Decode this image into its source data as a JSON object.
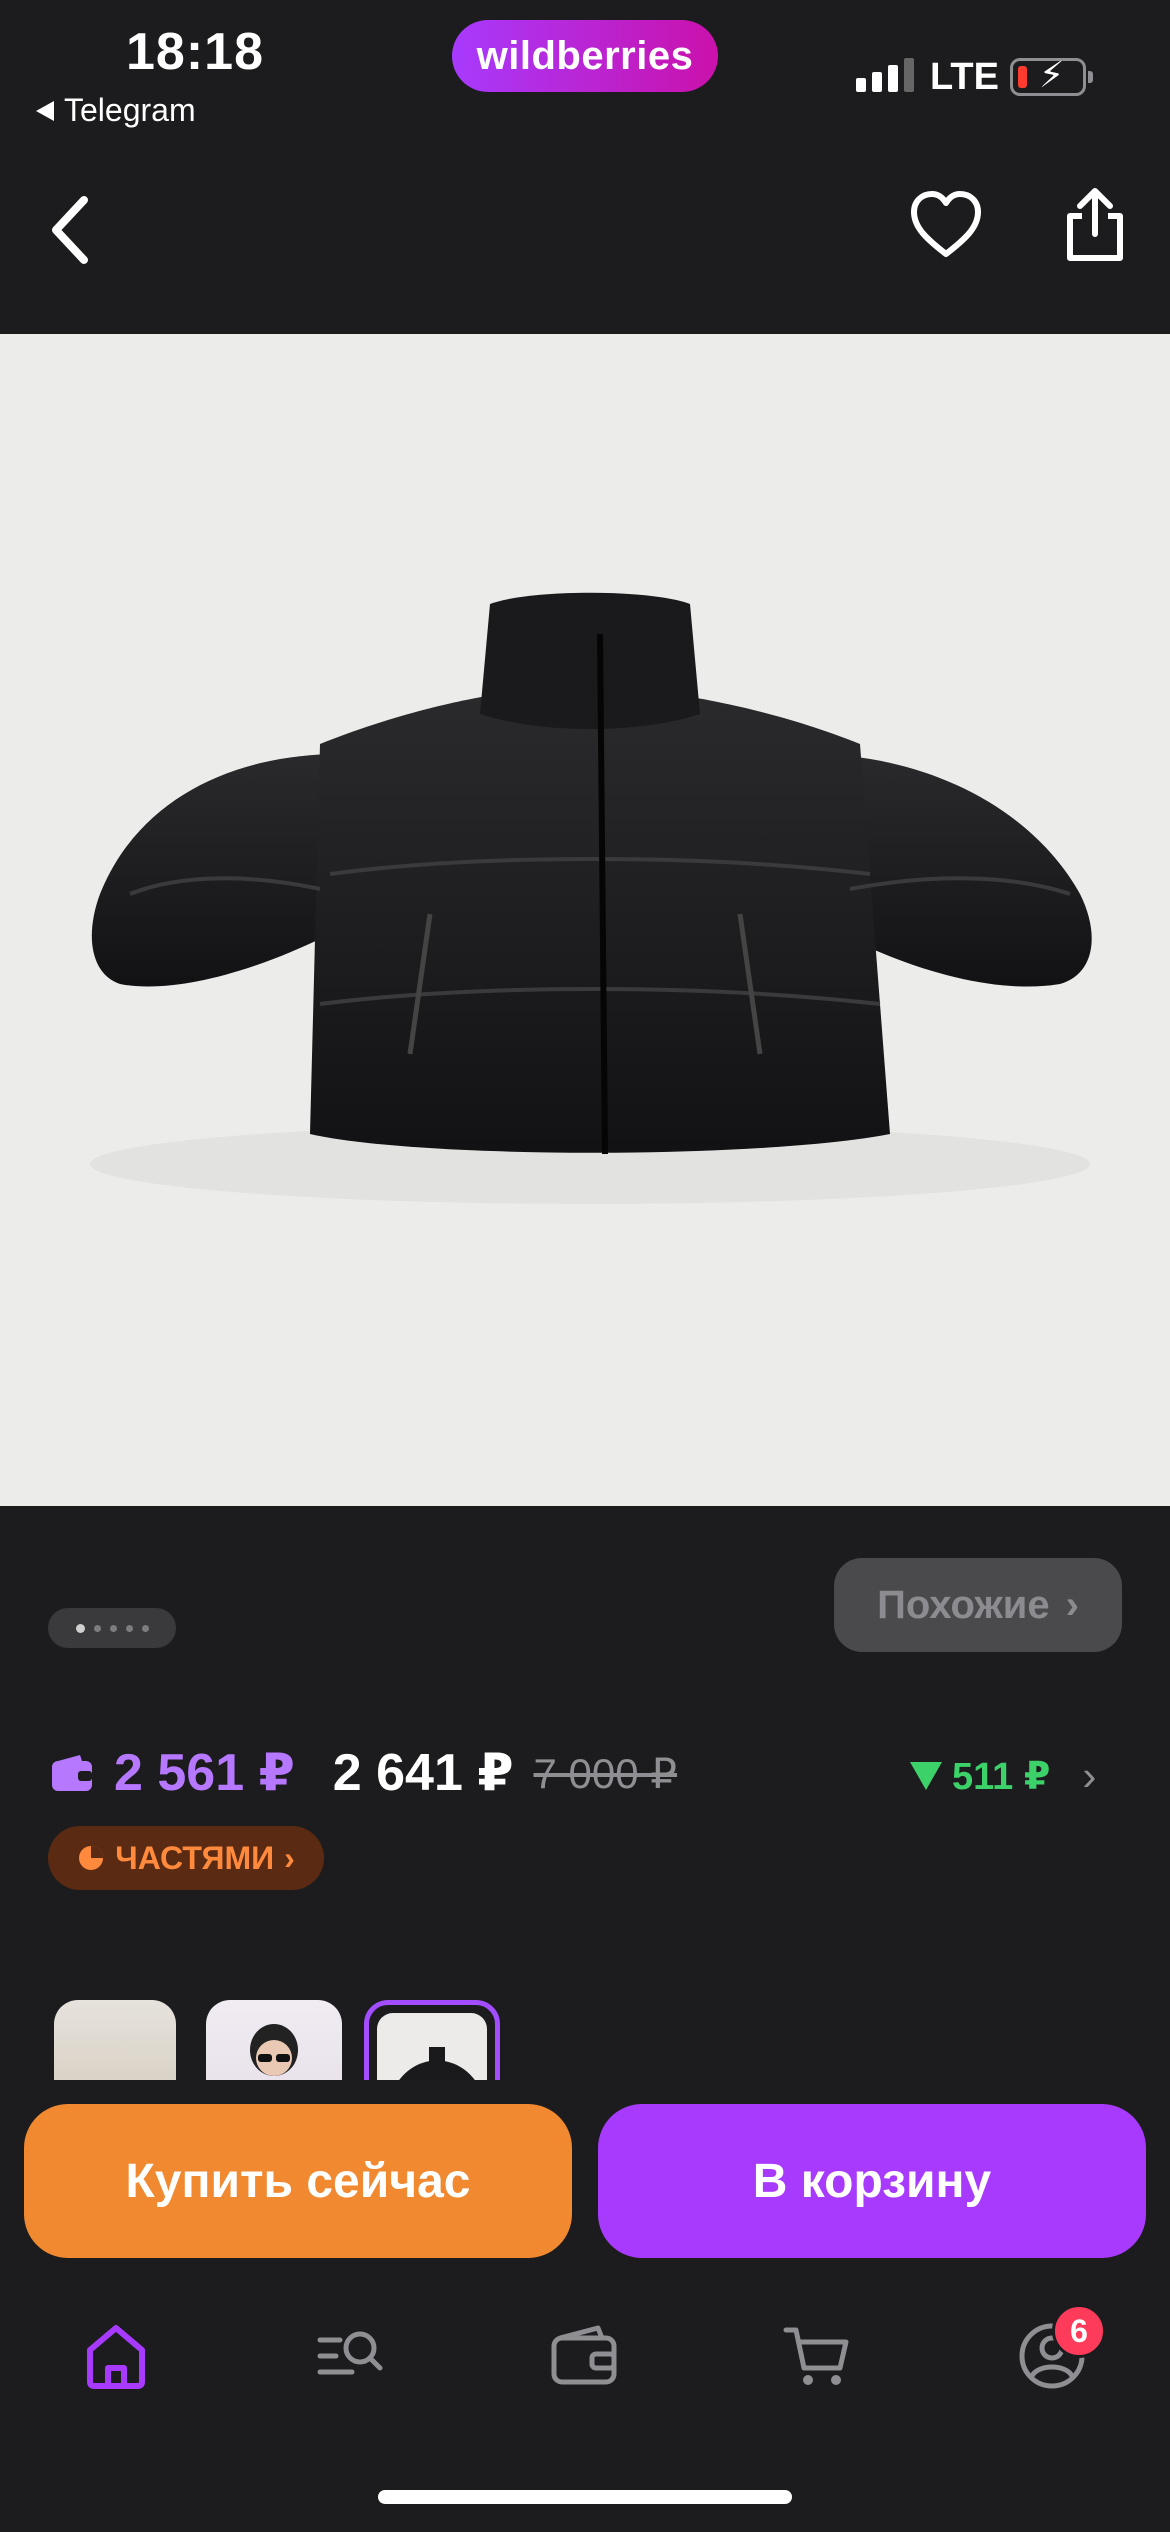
{
  "status_bar": {
    "time": "18:18",
    "back_app": "Telegram",
    "brand": "wildberries",
    "network": "LTE"
  },
  "product": {
    "price_wallet": "2 561 ₽",
    "price_current": "2 641 ₽",
    "price_old": "7 000 ₽",
    "price_drop": "511 ₽",
    "similar_label": "Похожие",
    "installments_label": "ЧАСТЯМИ",
    "gallery_total": 5,
    "gallery_current": 1
  },
  "actions": {
    "buy_now": "Купить сейчас",
    "add_to_cart": "В корзину"
  },
  "tabbar": {
    "items": [
      "home",
      "catalog-search",
      "wallet",
      "cart",
      "profile"
    ],
    "active": "home",
    "profile_badge": "6"
  },
  "colors": {
    "background": "#1c1c1e",
    "accent_purple": "#a73afd",
    "accent_orange": "#f0892f",
    "price_wallet": "#b678ff",
    "price_drop": "#3dd16a",
    "badge": "#ff3b5c"
  }
}
